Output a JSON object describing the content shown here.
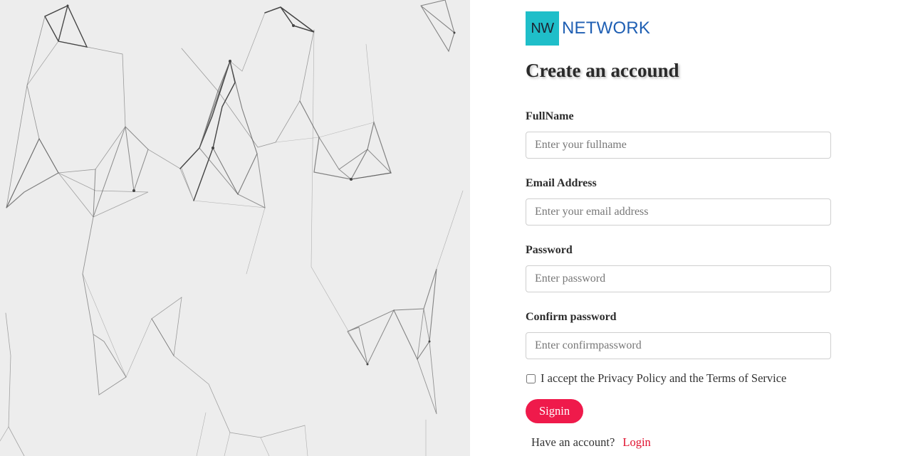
{
  "brand": {
    "mark": "NW",
    "name": "NETWORK",
    "mark_color": "#1fbec9",
    "name_color": "#1f5fb3"
  },
  "form": {
    "title": "Create an accound",
    "fields": [
      {
        "label": "FullName",
        "placeholder": "Enter your fullname",
        "value": ""
      },
      {
        "label": "Email Address",
        "placeholder": "Enter your email address",
        "value": ""
      },
      {
        "label": "Password",
        "placeholder": "Enter password",
        "value": ""
      },
      {
        "label": "Confirm password",
        "placeholder": "Enter confirmpassword",
        "value": ""
      }
    ],
    "terms_label": "I accept the Privacy Policy and the Terms of Service",
    "terms_checked": false,
    "submit_label": "Signin",
    "submit_color": "#ef1a4b",
    "account_prompt": "Have an account?",
    "login_link": "Login",
    "login_color": "#e0102e"
  },
  "background": {
    "panel_color": "#ededed",
    "pattern": "network-graph-pattern"
  }
}
